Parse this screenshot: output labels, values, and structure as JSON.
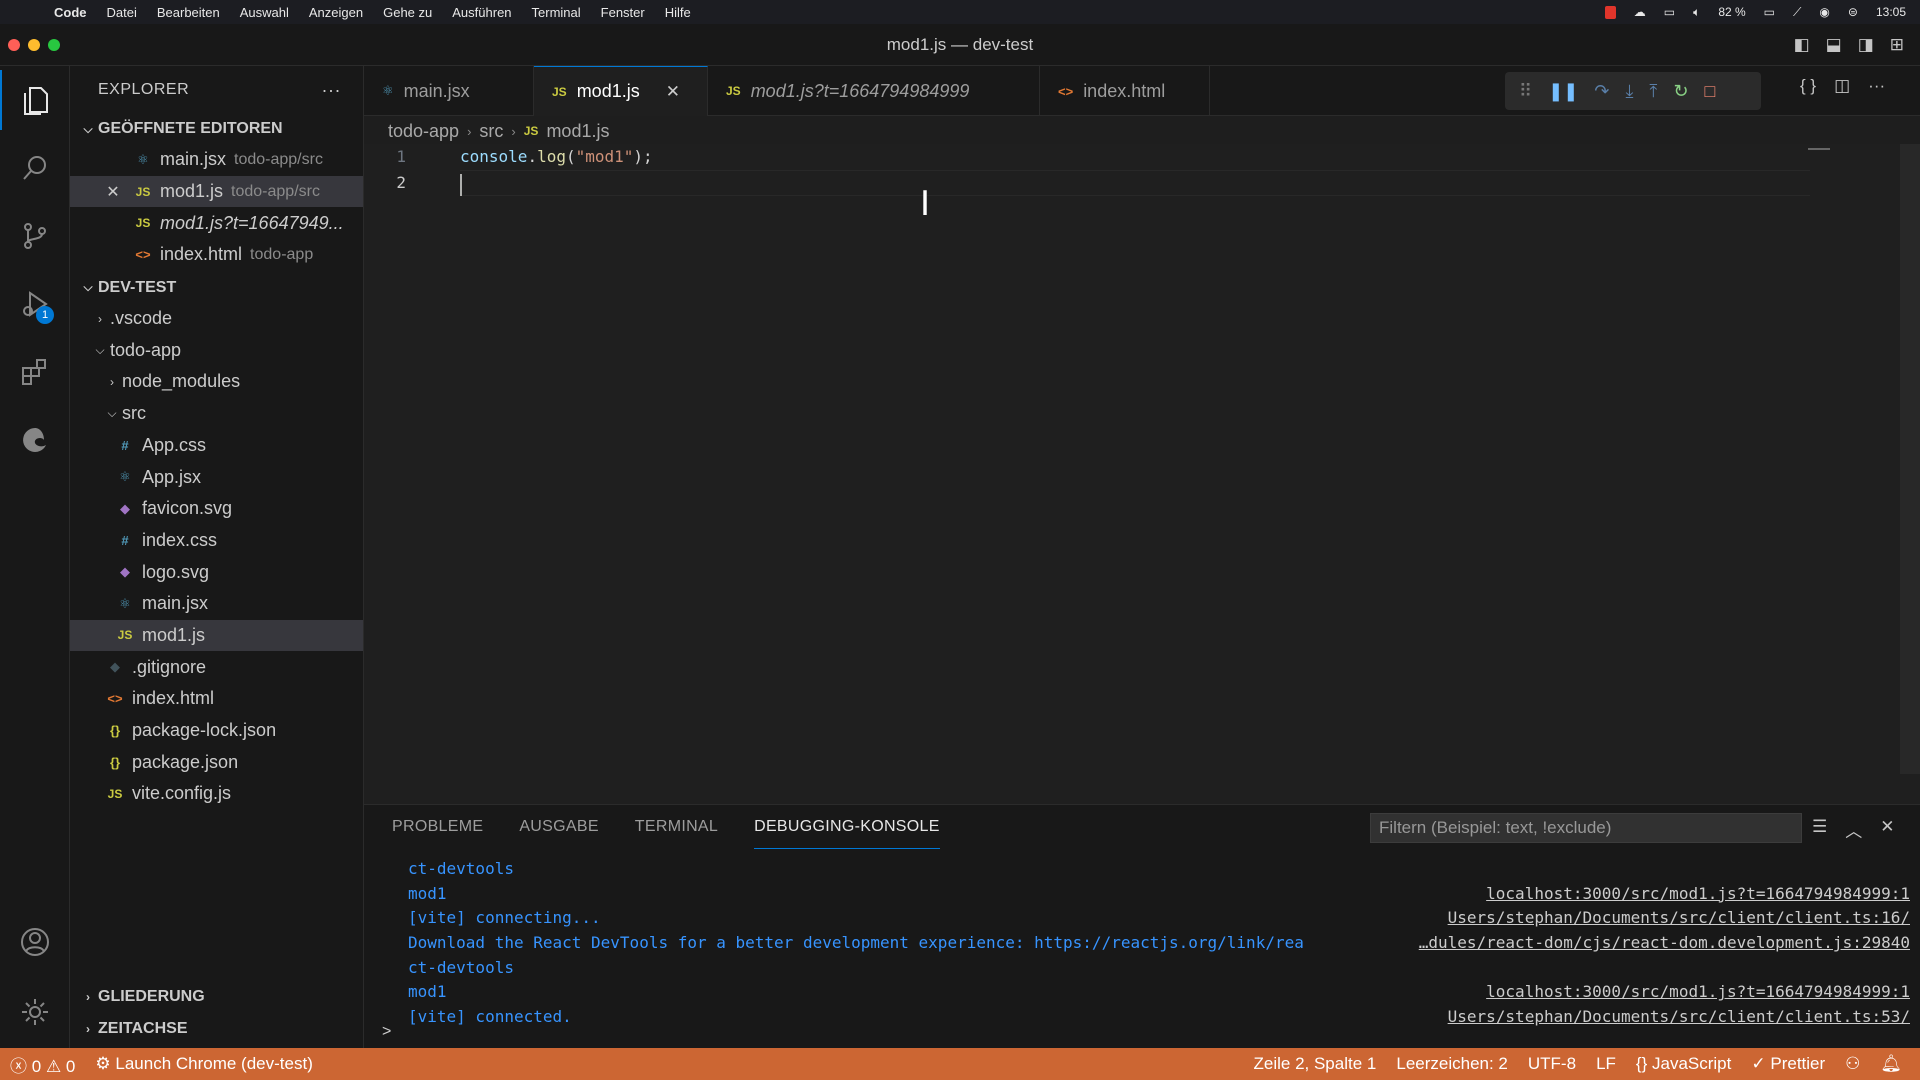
{
  "menubar": {
    "app": "Code",
    "items": [
      "Datei",
      "Bearbeiten",
      "Auswahl",
      "Anzeigen",
      "Gehe zu",
      "Ausführen",
      "Terminal",
      "Fenster",
      "Hilfe"
    ],
    "battery": "82 %",
    "clock": "13:05"
  },
  "window": {
    "title": "mod1.js — dev-test"
  },
  "activity": {
    "debug_badge": "1"
  },
  "sidebar": {
    "header": "EXPLORER",
    "more": "···",
    "open_editors_title": "GEÖFFNETE EDITOREN",
    "open_editors": [
      {
        "name": "main.jsx",
        "hint": "todo-app/src",
        "icon": "react"
      },
      {
        "name": "mod1.js",
        "hint": "todo-app/src",
        "icon": "js",
        "close": "✕"
      },
      {
        "name": "mod1.js?t=16647949...",
        "hint": "",
        "icon": "js"
      },
      {
        "name": "index.html",
        "hint": "todo-app",
        "icon": "html"
      }
    ],
    "workspace_title": "DEV-TEST",
    "tree": [
      {
        "name": ".vscode",
        "type": "folder-collapsed"
      },
      {
        "name": "todo-app",
        "type": "folder-open"
      },
      {
        "name": "node_modules",
        "type": "folder-collapsed"
      },
      {
        "name": "src",
        "type": "folder-open"
      },
      {
        "name": "App.css",
        "type": "css",
        "glyph": "#"
      },
      {
        "name": "App.jsx",
        "type": "react",
        "glyph": "⚛"
      },
      {
        "name": "favicon.svg",
        "type": "svg",
        "glyph": "◆"
      },
      {
        "name": "index.css",
        "type": "css",
        "glyph": "#"
      },
      {
        "name": "logo.svg",
        "type": "svg",
        "glyph": "◆"
      },
      {
        "name": "main.jsx",
        "type": "react",
        "glyph": "⚛"
      },
      {
        "name": "mod1.js",
        "type": "js",
        "glyph": "JS"
      },
      {
        "name": ".gitignore",
        "type": "git",
        "glyph": "◆"
      },
      {
        "name": "index.html",
        "type": "html",
        "glyph": "<>"
      },
      {
        "name": "package-lock.json",
        "type": "json",
        "glyph": "{}"
      },
      {
        "name": "package.json",
        "type": "json",
        "glyph": "{}"
      },
      {
        "name": "vite.config.js",
        "type": "js",
        "glyph": "JS"
      }
    ],
    "outline_title": "GLIEDERUNG",
    "timeline_title": "ZEITACHSE"
  },
  "tabs": [
    {
      "label": "main.jsx",
      "icon": "⚛"
    },
    {
      "label": "mod1.js",
      "icon": "JS",
      "close": "✕"
    },
    {
      "label": "mod1.js?t=1664794984999",
      "icon": "JS"
    },
    {
      "label": "index.html",
      "icon": "<>"
    }
  ],
  "breadcrumb": {
    "p1": "todo-app",
    "p2": "src",
    "p3": "mod1.js"
  },
  "editor": {
    "line_numbers": [
      "1",
      "2"
    ],
    "line1": {
      "obj": "console",
      "dot": ".",
      "fn": "log",
      "open": "(",
      "str": "\"mod1\"",
      "close": ");"
    }
  },
  "panel": {
    "tabs": [
      "PROBLEME",
      "AUSGABE",
      "TERMINAL",
      "DEBUGGING-KONSOLE"
    ],
    "filter_placeholder": "Filtern (Beispiel: text, !exclude)",
    "console": [
      {
        "msg": "ct-devtools",
        "src": ""
      },
      {
        "msg": "mod1",
        "src": "localhost:3000/src/mod1.js?t=1664794984999:1"
      },
      {
        "msg": "[vite] connecting...",
        "src": "Users/stephan/Documents/src/client/client.ts:16/"
      },
      {
        "msg": "Download the React DevTools for a better development experience: https://reactjs.org/link/rea",
        "src": "…dules/react-dom/cjs/react-dom.development.js:29840"
      },
      {
        "msg": "ct-devtools",
        "src": ""
      },
      {
        "msg": "mod1",
        "src": "localhost:3000/src/mod1.js?t=1664794984999:1"
      },
      {
        "msg": "[vite] connected.",
        "src": "Users/stephan/Documents/src/client/client.ts:53/"
      }
    ],
    "prompt": ">"
  },
  "statusbar": {
    "errors": "0",
    "warnings": "0",
    "launch": "Launch Chrome (dev-test)",
    "position": "Zeile 2, Spalte 1",
    "spaces": "Leerzeichen: 2",
    "encoding": "UTF-8",
    "eol": "LF",
    "language": "JavaScript",
    "formatter": "Prettier",
    "color": "#cc6633"
  }
}
